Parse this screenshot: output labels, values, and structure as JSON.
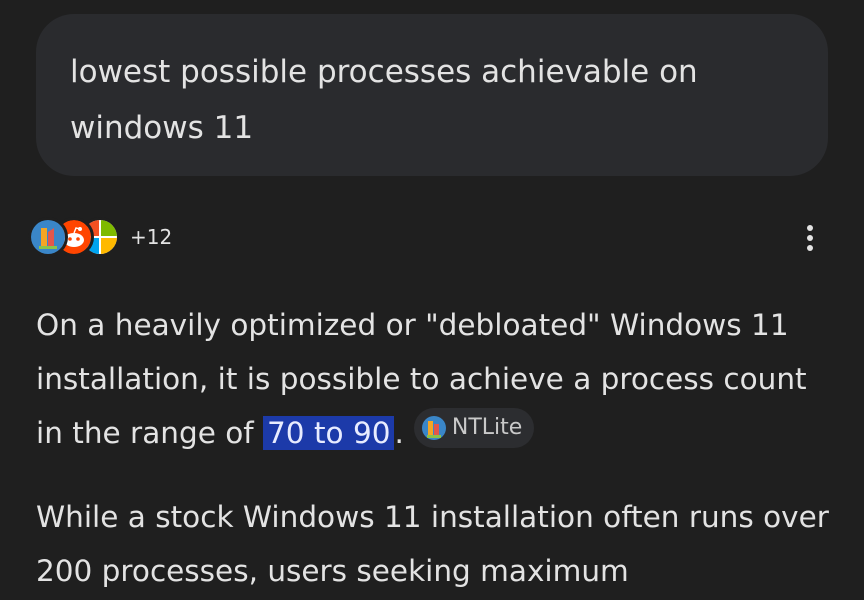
{
  "query": {
    "text": "lowest possible processes achievable on windows 11"
  },
  "sources": {
    "icons": [
      "ntlite-icon",
      "reddit-icon",
      "microsoft-icon"
    ],
    "more_count": "+12"
  },
  "answer": {
    "p1_before": "On a heavily optimized or \"debloated\" Windows 11 installation, it is possible to achieve a process count in the range of ",
    "p1_highlight": "70 to 90",
    "p1_after": ".",
    "citation_label": "NTLite",
    "p2": "While a stock Windows 11 installation often runs over 200 processes, users seeking maximum"
  },
  "colors": {
    "background": "#1f1f1f",
    "bubble": "#2a2b2e",
    "highlight": "#1c3aa9",
    "chip": "#2c2d30"
  }
}
